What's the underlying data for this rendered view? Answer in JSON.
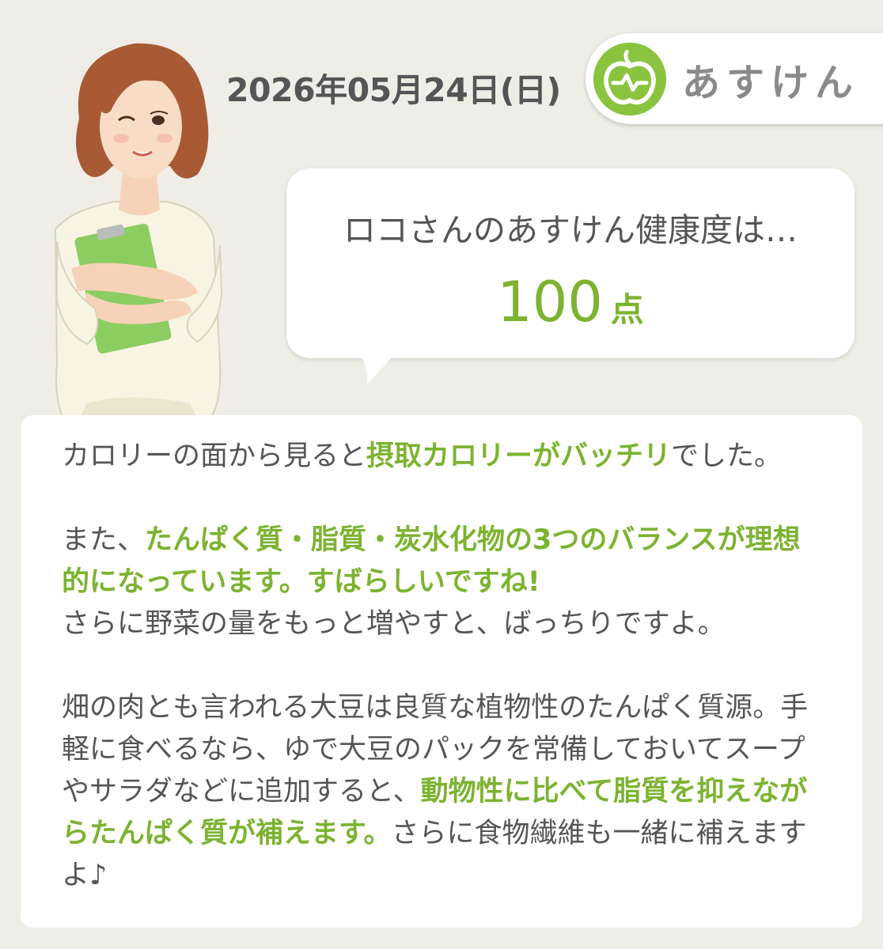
{
  "header": {
    "date": "2026年05月24日(日)",
    "brand_name": "あすけん",
    "brand_color": "#8ac43f"
  },
  "icons": {
    "logo": "apple-logo-icon",
    "character": "advisor-woman-illustration"
  },
  "bubble": {
    "lead": "ロコさんのあすけん健康度は…",
    "score": "100",
    "score_unit": "点",
    "accent_color": "#7cb330"
  },
  "advice": {
    "p1": {
      "t1": "カロリーの面から見ると",
      "h1": "摂取カロリーがバッチリ",
      "t2": "でした。"
    },
    "p2": {
      "t1": "また、",
      "h1": "たんぱく質・脂質・炭水化物の3つのバランスが理想的になっています。すばらしいですね!",
      "t2": "さらに野菜の量をもっと増やすと、ばっちりですよ。"
    },
    "p3": {
      "t1": "畑の肉とも言われる大豆は良質な植物性のたんぱく質源。手軽に食べるなら、ゆで大豆のパックを常備しておいてスープやサラダなどに追加すると、",
      "h1": "動物性に比べて脂質を抑えながらたんぱく質が補えます。",
      "t2": "さらに食物繊維も一緒に補えますよ♪"
    }
  }
}
